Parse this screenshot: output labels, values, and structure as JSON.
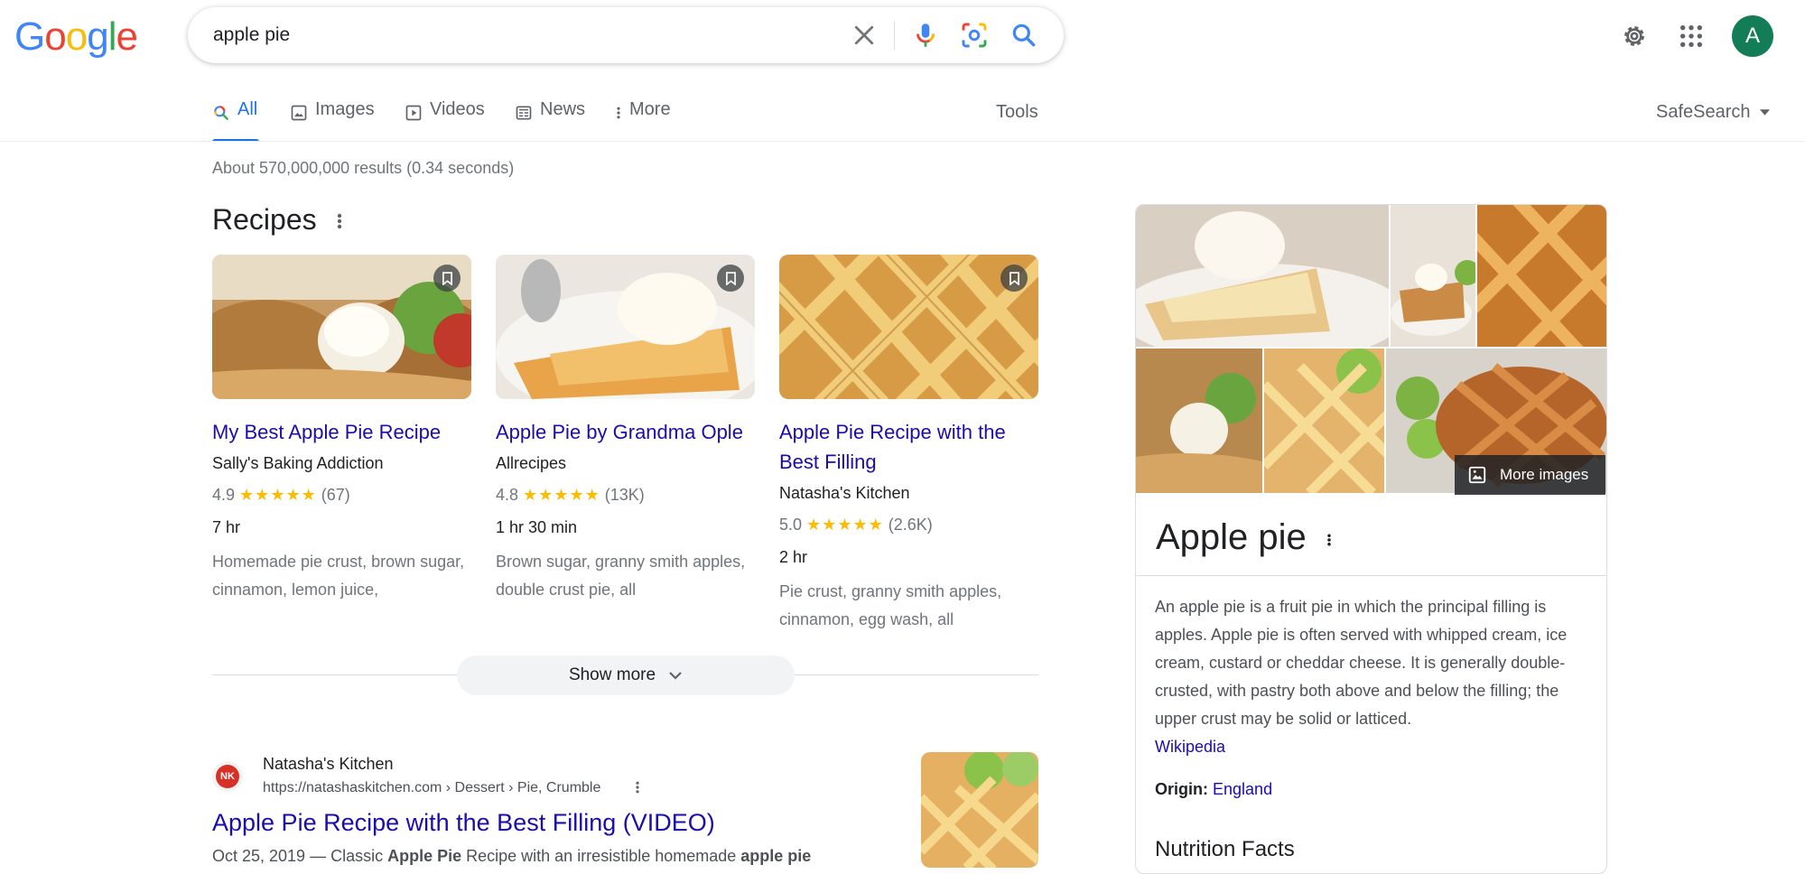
{
  "search": {
    "logo": "Google",
    "query": "apple pie"
  },
  "header": {
    "avatar_letter": "A"
  },
  "tabs": [
    {
      "label": "All",
      "icon": "search-icon"
    },
    {
      "label": "Images",
      "icon": "image-icon"
    },
    {
      "label": "Videos",
      "icon": "play-icon"
    },
    {
      "label": "News",
      "icon": "news-icon"
    },
    {
      "label": "More",
      "icon": "kebab-icon"
    }
  ],
  "toolbar": {
    "tools": "Tools",
    "safesearch": "SafeSearch"
  },
  "stats": "About 570,000,000 results (0.34 seconds)",
  "recipes": {
    "title": "Recipes",
    "cards": [
      {
        "title": "My Best Apple Pie Recipe",
        "source": "Sally's Baking Addiction",
        "rating": "4.9",
        "stars": "★★★★★",
        "reviews": "(67)",
        "time": "7 hr",
        "desc": "Homemade pie crust, brown sugar, cinnamon, lemon juice,"
      },
      {
        "title": "Apple Pie by Grandma Ople",
        "source": "Allrecipes",
        "rating": "4.8",
        "stars": "★★★★★",
        "reviews": "(13K)",
        "time": "1 hr 30 min",
        "desc": "Brown sugar, granny smith apples, double crust pie, all"
      },
      {
        "title": "Apple Pie Recipe with the Best Filling",
        "source": "Natasha's Kitchen",
        "rating": "5.0",
        "stars": "★★★★★",
        "reviews": "(2.6K)",
        "time": "2 hr",
        "desc": "Pie crust, granny smith apples, cinnamon, egg wash, all"
      }
    ],
    "show_more": "Show more"
  },
  "result": {
    "favicon": "NK",
    "site": "Natasha's Kitchen",
    "url": "https://natashaskitchen.com › Dessert › Pie, Crumble",
    "title": "Apple Pie Recipe with the Best Filling (VIDEO)",
    "date": "Oct 25, 2019",
    "snippet_a": " — Classic ",
    "snippet_b": "Apple Pie",
    "snippet_c": " Recipe with an irresistible homemade ",
    "snippet_d": "apple pie"
  },
  "knowledge_panel": {
    "more_images": "More images",
    "title": "Apple pie",
    "description": "An apple pie is a fruit pie in which the principal filling is apples. Apple pie is often served with whipped cream, ice cream, custard or cheddar cheese. It is generally double-crusted, with pastry both above and below the filling; the upper crust may be solid or latticed.",
    "source_link": "Wikipedia",
    "origin_label": "Origin:",
    "origin_value": "England",
    "nutrition_title": "Nutrition Facts"
  },
  "colors": {
    "link": "#1a0dab",
    "accent": "#1a73e8",
    "star": "#fbbc04",
    "avatar": "#137d57"
  }
}
